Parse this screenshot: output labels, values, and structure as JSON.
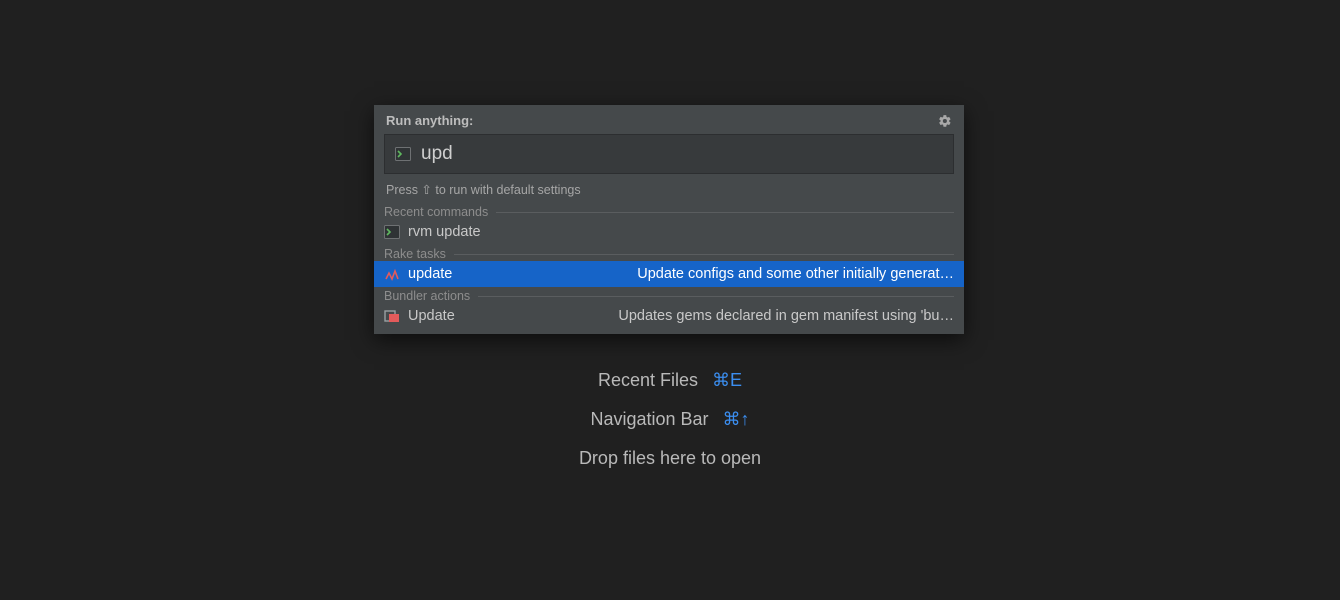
{
  "background_hints": [
    {
      "label": "Recent Files",
      "shortcut": "⌘E"
    },
    {
      "label": "Navigation Bar",
      "shortcut": "⌘↑"
    },
    {
      "label": "Drop files here to open",
      "shortcut": ""
    }
  ],
  "popup": {
    "title": "Run anything:",
    "search_value": "upd",
    "hint": "Press ⇧ to run with default settings",
    "sections": {
      "recent_commands": {
        "label": "Recent commands",
        "items": [
          {
            "text": "rvm update",
            "desc": ""
          }
        ]
      },
      "rake_tasks": {
        "label": "Rake tasks",
        "items": [
          {
            "text": "update",
            "desc": "Update configs and some other initially generat…",
            "selected": true
          }
        ]
      },
      "bundler_actions": {
        "label": "Bundler actions",
        "items": [
          {
            "text": "Update",
            "desc": "Updates gems declared in gem manifest using 'bu…"
          }
        ]
      }
    }
  }
}
